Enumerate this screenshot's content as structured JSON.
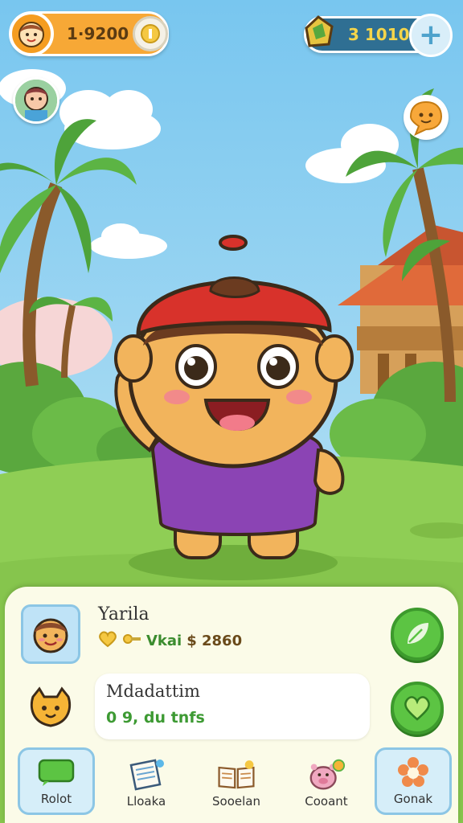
{
  "hud": {
    "coins": "1·9200",
    "gems": "3 1010"
  },
  "player": {
    "name": "Yarila",
    "stats_text": "Vkai",
    "money": "$ 2860"
  },
  "mission": {
    "title": "Mdadattim",
    "progress": "0 9, du tnfs"
  },
  "nav": {
    "items": [
      {
        "label": "Rolot",
        "icon": "chat-bubble-icon"
      },
      {
        "label": "Lloaka",
        "icon": "book-icon"
      },
      {
        "label": "Sooelan",
        "icon": "open-book-icon"
      },
      {
        "label": "Cooant",
        "icon": "pig-icon"
      },
      {
        "label": "Gonak",
        "icon": "flower-icon"
      }
    ],
    "active_index": 4
  },
  "colors": {
    "sky": "#8fd0ef",
    "grass": "#8fce55",
    "accent_green": "#5cc443",
    "hat_red": "#d8322b",
    "shirt_purple": "#8b44b4"
  }
}
